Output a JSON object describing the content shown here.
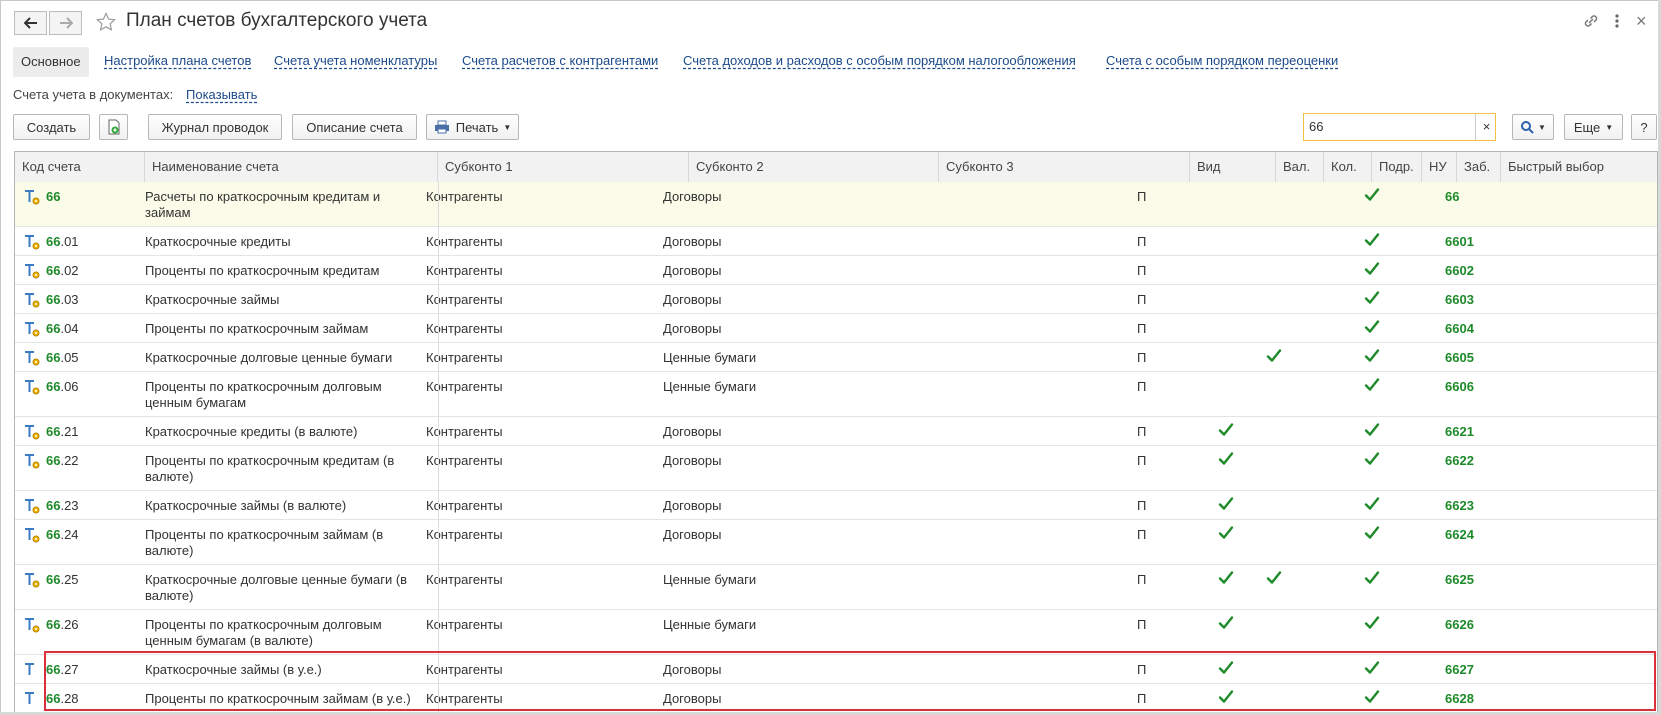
{
  "window": {
    "title": "План счетов бухгалтерского учета"
  },
  "tabs": [
    {
      "label": "Основное"
    },
    {
      "label": "Настройка плана счетов"
    },
    {
      "label": "Счета учета номенклатуры"
    },
    {
      "label": "Счета расчетов с контрагентами"
    },
    {
      "label": "Счета доходов и расходов с особым порядком налогообложения"
    },
    {
      "label": "Счета с особым порядком переоценки"
    }
  ],
  "accounts_in_docs": {
    "label": "Счета учета в документах:",
    "value": "Показывать"
  },
  "toolbar": {
    "create": "Создать",
    "journal": "Журнал проводок",
    "description": "Описание счета",
    "print": "Печать",
    "more": "Еще",
    "help": "?",
    "search_value": "66",
    "clear": "×"
  },
  "columns": [
    "Код счета",
    "Наименование счета",
    "Субконто 1",
    "Субконто 2",
    "Субконто 3",
    "Вид",
    "Вал.",
    "Кол.",
    "Подр.",
    "НУ",
    "Заб.",
    "Быстрый выбор"
  ],
  "rows": [
    {
      "code_main": "66",
      "code_sub": "",
      "name": "Расчеты по краткосрочным кредитам и займам",
      "sub1": "Контрагенты",
      "sub2": "Договоры",
      "sub3": "",
      "kind": "П",
      "val": false,
      "qty": false,
      "nu": true,
      "quick": "66",
      "icon": "t-gear"
    },
    {
      "code_main": "66",
      "code_sub": ".01",
      "name": "Краткосрочные кредиты",
      "sub1": "Контрагенты",
      "sub2": "Договоры",
      "sub3": "",
      "kind": "П",
      "val": false,
      "qty": false,
      "nu": true,
      "quick": "6601",
      "icon": "t-gear"
    },
    {
      "code_main": "66",
      "code_sub": ".02",
      "name": "Проценты по краткосрочным кредитам",
      "sub1": "Контрагенты",
      "sub2": "Договоры",
      "sub3": "",
      "kind": "П",
      "val": false,
      "qty": false,
      "nu": true,
      "quick": "6602",
      "icon": "t-gear"
    },
    {
      "code_main": "66",
      "code_sub": ".03",
      "name": "Краткосрочные займы",
      "sub1": "Контрагенты",
      "sub2": "Договоры",
      "sub3": "",
      "kind": "П",
      "val": false,
      "qty": false,
      "nu": true,
      "quick": "6603",
      "icon": "t-gear"
    },
    {
      "code_main": "66",
      "code_sub": ".04",
      "name": "Проценты по краткосрочным займам",
      "sub1": "Контрагенты",
      "sub2": "Договоры",
      "sub3": "",
      "kind": "П",
      "val": false,
      "qty": false,
      "nu": true,
      "quick": "6604",
      "icon": "t-gear"
    },
    {
      "code_main": "66",
      "code_sub": ".05",
      "name": "Краткосрочные долговые ценные бумаги",
      "sub1": "Контрагенты",
      "sub2": "Ценные бумаги",
      "sub3": "",
      "kind": "П",
      "val": false,
      "qty": true,
      "nu": true,
      "quick": "6605",
      "icon": "t-gear"
    },
    {
      "code_main": "66",
      "code_sub": ".06",
      "name": "Проценты по краткосрочным долговым ценным бумагам",
      "sub1": "Контрагенты",
      "sub2": "Ценные бумаги",
      "sub3": "",
      "kind": "П",
      "val": false,
      "qty": false,
      "nu": true,
      "quick": "6606",
      "icon": "t-gear"
    },
    {
      "code_main": "66",
      "code_sub": ".21",
      "name": "Краткосрочные кредиты (в валюте)",
      "sub1": "Контрагенты",
      "sub2": "Договоры",
      "sub3": "",
      "kind": "П",
      "val": true,
      "qty": false,
      "nu": true,
      "quick": "6621",
      "icon": "t-gear"
    },
    {
      "code_main": "66",
      "code_sub": ".22",
      "name": "Проценты по краткосрочным кредитам (в валюте)",
      "sub1": "Контрагенты",
      "sub2": "Договоры",
      "sub3": "",
      "kind": "П",
      "val": true,
      "qty": false,
      "nu": true,
      "quick": "6622",
      "icon": "t-gear"
    },
    {
      "code_main": "66",
      "code_sub": ".23",
      "name": "Краткосрочные займы (в валюте)",
      "sub1": "Контрагенты",
      "sub2": "Договоры",
      "sub3": "",
      "kind": "П",
      "val": true,
      "qty": false,
      "nu": true,
      "quick": "6623",
      "icon": "t-gear"
    },
    {
      "code_main": "66",
      "code_sub": ".24",
      "name": "Проценты по краткосрочным займам (в валюте)",
      "sub1": "Контрагенты",
      "sub2": "Договоры",
      "sub3": "",
      "kind": "П",
      "val": true,
      "qty": false,
      "nu": true,
      "quick": "6624",
      "icon": "t-gear"
    },
    {
      "code_main": "66",
      "code_sub": ".25",
      "name": "Краткосрочные долговые ценные бумаги (в валюте)",
      "sub1": "Контрагенты",
      "sub2": "Ценные бумаги",
      "sub3": "",
      "kind": "П",
      "val": true,
      "qty": true,
      "nu": true,
      "quick": "6625",
      "icon": "t-gear"
    },
    {
      "code_main": "66",
      "code_sub": ".26",
      "name": "Проценты по краткосрочным долговым ценным бумагам (в валюте)",
      "sub1": "Контрагенты",
      "sub2": "Ценные бумаги",
      "sub3": "",
      "kind": "П",
      "val": true,
      "qty": false,
      "nu": true,
      "quick": "6626",
      "icon": "t-gear"
    },
    {
      "code_main": "66",
      "code_sub": ".27",
      "name": "Краткосрочные займы (в у.е.)",
      "sub1": "Контрагенты",
      "sub2": "Договоры",
      "sub3": "",
      "kind": "П",
      "val": true,
      "qty": false,
      "nu": true,
      "quick": "6627",
      "icon": "t-plain"
    },
    {
      "code_main": "66",
      "code_sub": ".28",
      "name": "Проценты по краткосрочным займам (в у.е.)",
      "sub1": "Контрагенты",
      "sub2": "Договоры",
      "sub3": "",
      "kind": "П",
      "val": true,
      "qty": false,
      "nu": true,
      "quick": "6628",
      "icon": "t-plain"
    }
  ],
  "colors": {
    "link": "#1c4a8a",
    "code_green": "#1e8a2a",
    "check_green": "#1e8a2a",
    "highlight": "#d9313b",
    "search_border": "#f0c040"
  }
}
